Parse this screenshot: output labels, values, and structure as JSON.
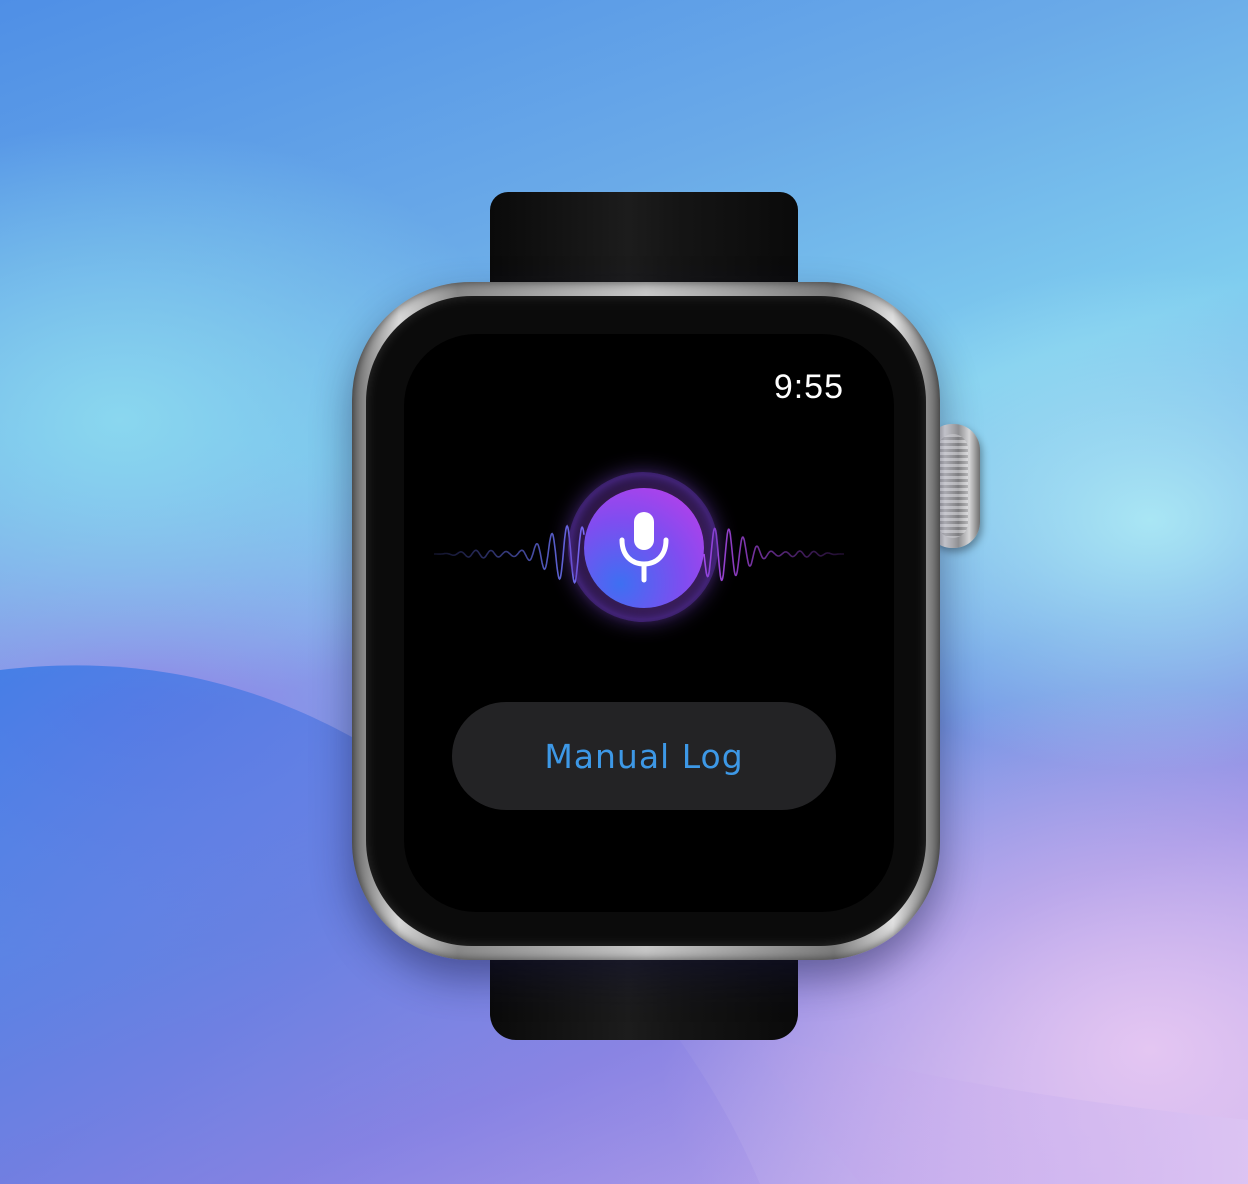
{
  "status_bar": {
    "time": "9:55"
  },
  "voice_input": {
    "icon": "microphone-icon",
    "accent_colors": [
      "#3e6ff2",
      "#7f4df0",
      "#c43ce8"
    ]
  },
  "actions": {
    "manual_log_label": "Manual Log",
    "manual_log_color": "#3d98e6"
  }
}
